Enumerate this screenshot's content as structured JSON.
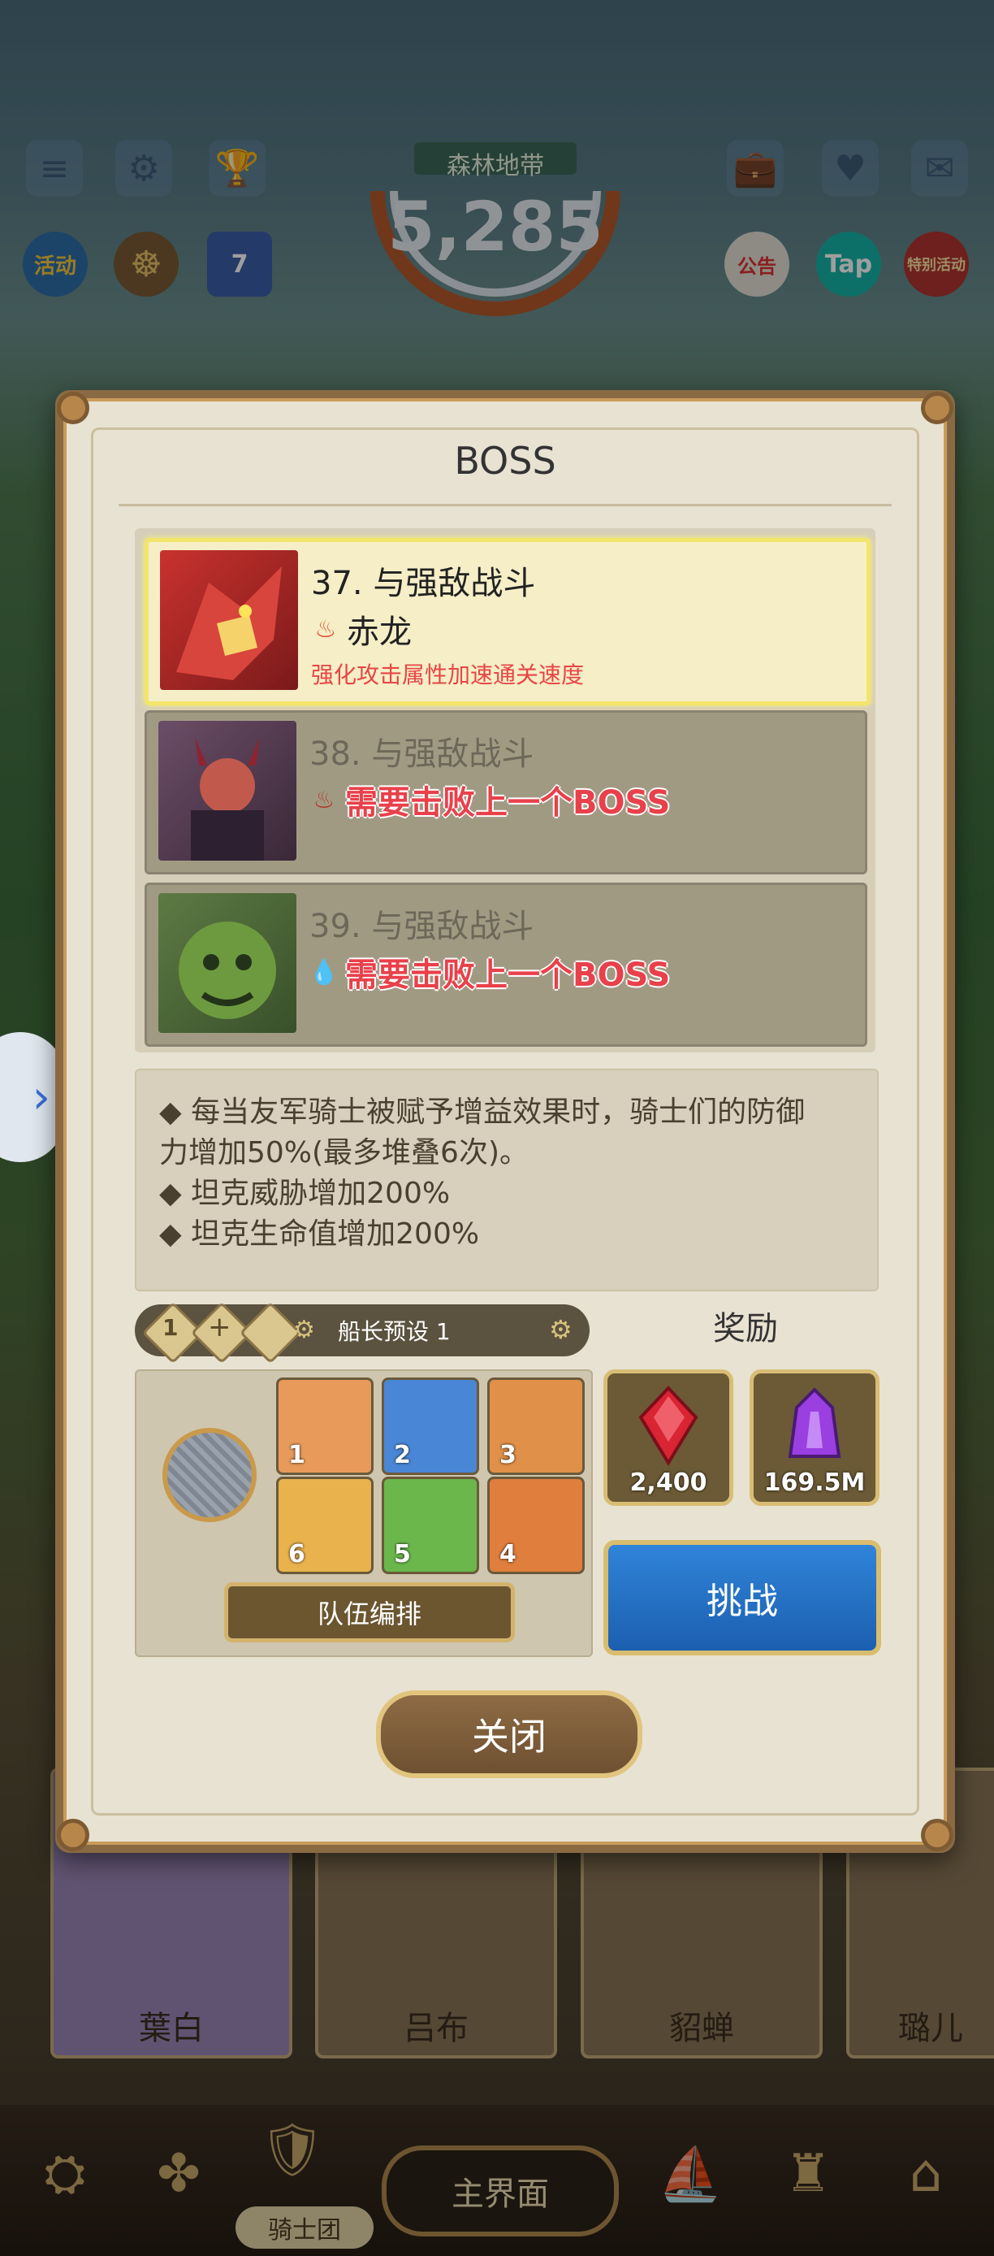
{
  "hud": {
    "region_label": "森林地带",
    "score": "5,285",
    "left_icons": [
      "menu-icon",
      "gear-icon",
      "trophy-icon"
    ],
    "row2_icons": [
      {
        "name": "event-icon",
        "label": "活动"
      },
      {
        "name": "helm-icon",
        "label": ""
      },
      {
        "name": "calendar-icon",
        "label": "7"
      }
    ],
    "right_icons": [
      {
        "name": "notice-icon",
        "label": "公告"
      },
      {
        "name": "tap-icon",
        "label": "Tap"
      },
      {
        "name": "special-icon",
        "label": "特别活动"
      }
    ],
    "side_arrow": "›"
  },
  "modal": {
    "title": "BOSS",
    "bosses": [
      {
        "name": "37. 与强敌战斗",
        "element": "fire",
        "subtitle": "赤龙",
        "desc": "强化攻击属性加速通关速度",
        "state": "active"
      },
      {
        "name": "38. 与强敌战斗",
        "element": "fire",
        "subtitle": "需要击败上一个BOSS",
        "state": "locked"
      },
      {
        "name": "39. 与强敌战斗",
        "element": "water",
        "subtitle": "需要击败上一个BOSS",
        "state": "locked"
      }
    ],
    "effects": [
      "◆ 每当友军骑士被赋予增益效果时，骑士们的防御",
      "力增加50%(最多堆叠6次)。",
      "◆ 坦克威胁增加200%",
      "◆ 坦克生命值增加200%"
    ],
    "preset": {
      "slot_label": "1",
      "label": "船长预设 1"
    },
    "reward_title": "奖励",
    "rewards": [
      {
        "name": "red-gem",
        "amount": "2,400",
        "color": "#d92433"
      },
      {
        "name": "purple-crystal",
        "amount": "169.5M",
        "color": "#9a3fe0"
      }
    ],
    "team": [
      {
        "slot": "1",
        "color": "#e79a5a"
      },
      {
        "slot": "2",
        "color": "#4a86d6"
      },
      {
        "slot": "3",
        "color": "#e09048"
      },
      {
        "slot": "6",
        "color": "#e9b24c"
      },
      {
        "slot": "5",
        "color": "#6bb74c"
      },
      {
        "slot": "4",
        "color": "#e07e3e"
      }
    ],
    "formation_button": "队伍编排",
    "challenge_button": "挑战",
    "close_button": "关闭"
  },
  "hero_cards": [
    "葉白",
    "吕布",
    "貂蝉",
    "璐儿"
  ],
  "bottom_nav": {
    "knights_label": "骑士团",
    "main_button": "主界面"
  }
}
